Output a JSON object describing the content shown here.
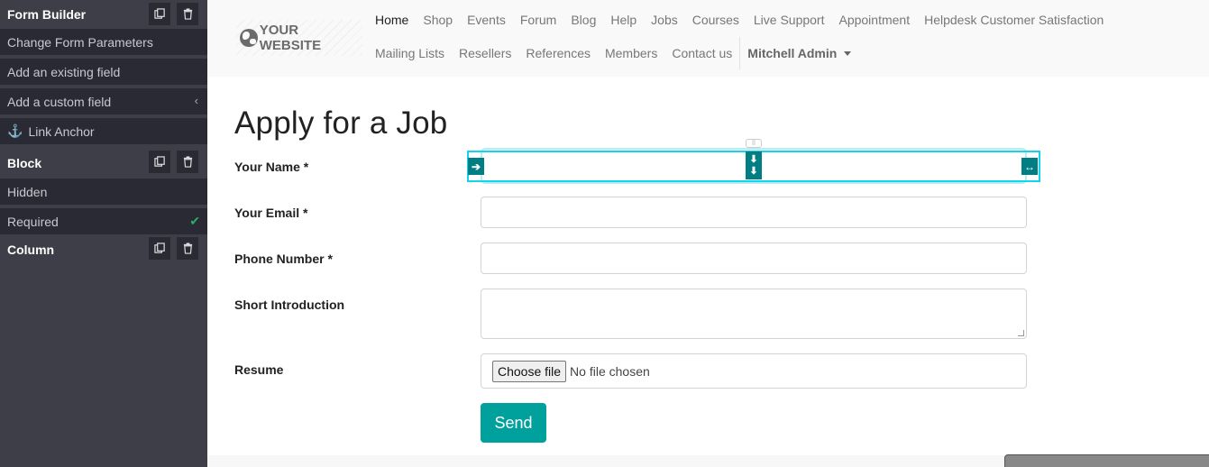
{
  "sidebar": {
    "form_builder": {
      "title": "Form Builder",
      "clone_icon": "clone-icon",
      "delete_icon": "trash-icon"
    },
    "form_items": [
      {
        "label": "Change Form Parameters"
      },
      {
        "label": "Add an existing field"
      },
      {
        "label": "Add a custom field",
        "icon": "chevron-left-icon",
        "glyph": "‹"
      },
      {
        "label": "Link Anchor",
        "icon": "anchor-icon",
        "glyph": "⚓"
      }
    ],
    "block": {
      "title": "Block"
    },
    "block_items": [
      {
        "label": "Hidden"
      },
      {
        "label": "Required",
        "checked": true,
        "glyph": "✔"
      }
    ],
    "column": {
      "title": "Column"
    }
  },
  "header": {
    "logo_text": "YOUR WEBSITE",
    "nav_row1": [
      "Home",
      "Shop",
      "Events",
      "Forum",
      "Blog",
      "Help",
      "Jobs",
      "Courses",
      "Live Support",
      "Appointment",
      "Helpdesk Customer Satisfaction"
    ],
    "nav_row2": [
      "Mailing Lists",
      "Resellers",
      "References",
      "Members",
      "Contact us"
    ],
    "active": "Home",
    "user": "Mitchell Admin"
  },
  "form": {
    "title": "Apply for a Job",
    "fields": [
      {
        "label": "Your Name *",
        "value": ""
      },
      {
        "label": "Your Email *",
        "value": ""
      },
      {
        "label": "Phone Number *",
        "value": ""
      },
      {
        "label": "Short Introduction",
        "value": ""
      },
      {
        "label": "Resume",
        "file_button": "Choose file",
        "file_status": "No file chosen"
      }
    ],
    "submit_label": "Send"
  },
  "overlay": {
    "left_glyph": "➔",
    "mid_glyphs": [
      "⬇",
      "⬇"
    ],
    "right_glyph": "↔",
    "grip_glyph": "⠿"
  },
  "colors": {
    "sidebar_bg": "#3e3e48",
    "sidebar_row_bg": "#2a2a35",
    "accent": "#00a09d",
    "overlay_border": "#10d5ec",
    "handle_bg": "#017e84",
    "check": "#27ae60"
  }
}
